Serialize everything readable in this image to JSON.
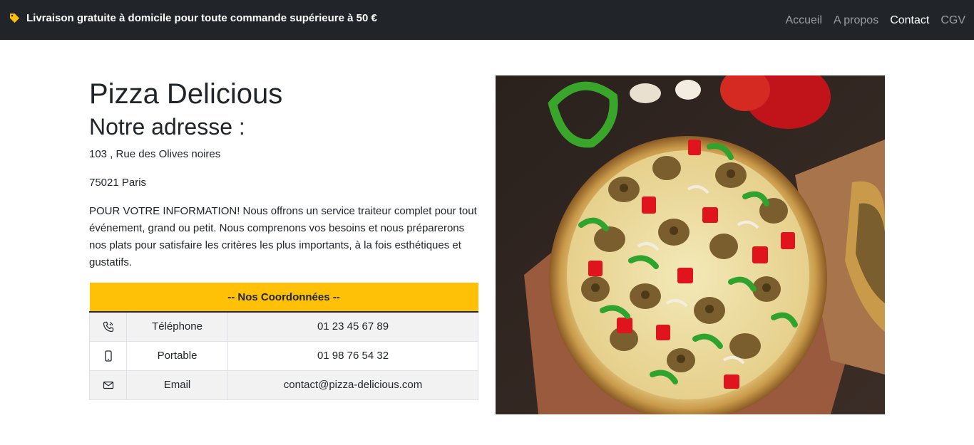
{
  "navbar": {
    "promo_text": "Livraison gratuite à domicile pour toute commande supérieure à 50 €",
    "promo_icon": "tag-icon",
    "promo_icon_color": "#ffc107",
    "links": [
      {
        "label": "Accueil",
        "active": false
      },
      {
        "label": "A propos",
        "active": false
      },
      {
        "label": "Contact",
        "active": true
      },
      {
        "label": "CGV",
        "active": false
      }
    ]
  },
  "main": {
    "brand": "Pizza Delicious",
    "address_heading": "Notre adresse :",
    "street": "103 , Rue des Olives noires",
    "city": "75021 Paris",
    "info": "POUR VOTRE INFORMATION! Nous offrons un service traiteur complet pour tout événement, grand ou petit. Nous comprenons vos besoins et nous préparerons nos plats pour satisfaire les critères les plus importants, à la fois esthétiques et gustatifs."
  },
  "contact_table": {
    "header": "-- Nos Coordonnées --",
    "header_color": "#ffc107",
    "rows": [
      {
        "icon": "phone-icon",
        "label": "Téléphone",
        "value": "01 23 45 67 89"
      },
      {
        "icon": "mobile-icon",
        "label": "Portable",
        "value": "01 98 76 54 32"
      },
      {
        "icon": "mail-icon",
        "label": "Email",
        "value": "contact@pizza-delicious.com"
      }
    ]
  },
  "image": {
    "subject": "pizza-photo"
  }
}
